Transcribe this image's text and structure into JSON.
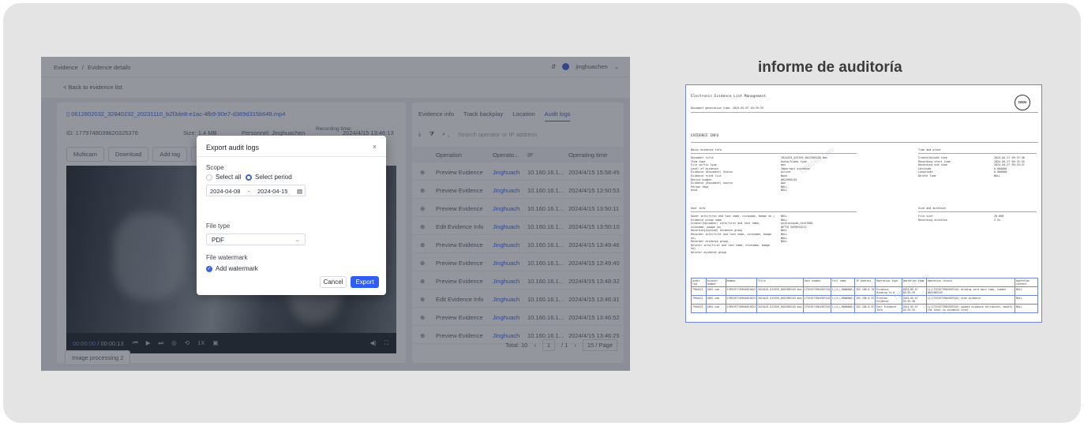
{
  "card_title": "informe de auditoría",
  "app": {
    "breadcrumb": [
      "Evidence",
      "Evidence details"
    ],
    "user_name": "jinghuachen",
    "top_icon_glyph": "⇵",
    "back_link": "< Back to evidence list",
    "file_name": "0612802032_32840232_20231110_b2f3de8-e1ac-4fb9-90e7-d389d315b648.mp4",
    "meta": {
      "id": "ID: 1779748039620325376",
      "size": "Size: 1.4 MB",
      "personnel": "Personnel: Jinghuachen",
      "recording_label": "Recording time:",
      "recording_value": "2024/4/15 13:46:13"
    },
    "action_buttons": [
      "Multicam",
      "Download",
      "Add tag",
      "Share"
    ],
    "video": {
      "time_current": "00:00:00",
      "time_total": "/ 00:00:13",
      "speed": "1X"
    },
    "image_processing_button": "Image processing 2",
    "right_tabs": [
      "Evidence info",
      "Track backplay",
      "Location",
      "Audit logs"
    ],
    "active_tab_index": 3,
    "search_placeholder": "Search operator or IP address",
    "table_headers": [
      "Operation",
      "Operato...",
      "IP",
      "Operating time"
    ],
    "audit_rows": [
      {
        "op": "Preview Evidence",
        "user": "Jinghuach",
        "ip": "10.160.16.1...",
        "time": "2024/4/15 15:58:45"
      },
      {
        "op": "Preview Evidence",
        "user": "Jinghuach",
        "ip": "10.160.16.1...",
        "time": "2024/4/15 13:50:53"
      },
      {
        "op": "Preview Evidence",
        "user": "Jinghuach",
        "ip": "10.160.16.1...",
        "time": "2024/4/15 13:50:11"
      },
      {
        "op": "Edit Evidence Info",
        "user": "Jinghuach",
        "ip": "10.160.16.1...",
        "time": "2024/4/15 13:50:10"
      },
      {
        "op": "Preview Evidence",
        "user": "Jinghuach",
        "ip": "10.160.16.1...",
        "time": "2024/4/15 13:49:46"
      },
      {
        "op": "Preview Evidence",
        "user": "Jinghuach",
        "ip": "10.160.16.1...",
        "time": "2024/4/15 13:49:40"
      },
      {
        "op": "Preview Evidence",
        "user": "Jinghuach",
        "ip": "10.160.16.1...",
        "time": "2024/4/15 13:48:32"
      },
      {
        "op": "Edit Evidence Info",
        "user": "Jinghuach",
        "ip": "10.160.16.1...",
        "time": "2024/4/15 13:46:31"
      },
      {
        "op": "Preview Evidence",
        "user": "Jinghuach",
        "ip": "10.160.16.1...",
        "time": "2024/4/15 13:46:52"
      },
      {
        "op": "Preview Evidence",
        "user": "Jinghuach",
        "ip": "10.160.16.1...",
        "time": "2024/4/15 13:46:25"
      }
    ],
    "pager": {
      "total": "Total: 10",
      "page": "1",
      "of": "/ 1",
      "per_page": "15 / Page"
    }
  },
  "dialog": {
    "title": "Export audit logs",
    "close": "×",
    "scope_label": "Scope",
    "select_all": "Select all",
    "select_period": "Select period",
    "selected_scope": "Select period",
    "date_from": "2024-04-08",
    "date_sep": "-",
    "date_to": "2024-04-15",
    "file_type_label": "File type",
    "file_type_value": "PDF",
    "watermark_label": "File watermark",
    "add_watermark": "Add watermark",
    "add_watermark_checked": true,
    "cancel": "Cancel",
    "export": "Export"
  },
  "report": {
    "title": "Electronic Evidence List Management",
    "generated": "Document generation time: 2024-05-07 16:35:39",
    "badge": "DEM",
    "section": "EVIDENCE INFO",
    "basic_header": "Basic evidence info",
    "time_header": "Time and place",
    "user_header": "User info",
    "size_header": "Size and duration",
    "basic_lines": [
      "Document title",
      "Item type",
      "File suffix type",
      "Level of evidence",
      "Evidence (Document) Status",
      "Evidence rules list",
      "Device number",
      "Evidence (Document) source",
      "Person tags",
      "mind"
    ],
    "basic_values": [
      "2024425_013359_0022905245.mov",
      "Audio/Video type",
      "mov",
      "Important evidence",
      "Active",
      "None",
      "0022905245",
      "Own",
      "NULL",
      "NULL"
    ],
    "time_lines": [
      "Create/Upload time",
      "Recording start time",
      "Recording end time",
      "Latitude",
      "Longitude",
      "Delete Time"
    ],
    "time_values": [
      "2024-04-27 09:37:46",
      "2024-04-27 09:31:35",
      "2024-04-27 09:33:37",
      "0.000000",
      "0.000000",
      "NULL"
    ],
    "user_lines": [
      "Owner info(first and last name, nickname, badge no.)",
      "Evidence group name",
      "Creator(Uploader) info(first and last name, nickname, badge no)",
      "Recording(Upload) evidence group",
      "Recorder info(first and last name, nickname, badge no)",
      "Recorder evidence group",
      "Deleter info(first and last name, nickname, badge no)",
      "Deleter evidence group"
    ],
    "user_values": [
      "NULL",
      "NULL",
      "psyhiaispeb,test5001",
      "BETTO SUPERYOC12",
      "NULL",
      "NULL",
      "NULL",
      "NULL"
    ],
    "size_lines": [
      "File size",
      "Recording duration"
    ],
    "size_values": [
      "28.0KB",
      "2.5s"
    ],
    "watermark_text": "Lj56269.com",
    "table_headers": [
      "Audit log",
      "Account number",
      "Number",
      "Title",
      "User number",
      "Full name",
      "IP Address",
      "Operation type",
      "Operation time",
      "Operation record",
      "Operation content"
    ],
    "table_rows": [
      [
        "7904421",
        "1001.com",
        "1789297749034822023",
        "2024425_013359_0022905245.mov",
        "17325573904387510",
        "Lj(Lj,0000000)",
        "192.168.8.76",
        "Evidence Binding To 8",
        "2024-05-07 16:35:39",
        "Lj(17325573904387510) binding card main logo, number 0022905245",
        "NULL"
      ],
      [
        "7904422",
        "1001.com",
        "1789297749034822023",
        "2024425_013359_0022905245.mov",
        "17325573904387510",
        "Lj(Lj,0000000)",
        "192.168.8.32",
        "Preview Evidence",
        "2024-05-07 16:35:38",
        "Lj(17325573904387510) view evidence",
        "NULL"
      ],
      [
        "7904423",
        "1001.com",
        "1789297749034822023",
        "2024425_013359_0022905245.mov",
        "17325573904387510",
        "Lj(Lj,0000000)",
        "192.168.8.32",
        "Edit Evidence Info",
        "2024-05-07 16:35:35",
        "Lj(17325573904387510) update evidence attributes, modify the level to evidence level",
        "NULL"
      ]
    ]
  }
}
